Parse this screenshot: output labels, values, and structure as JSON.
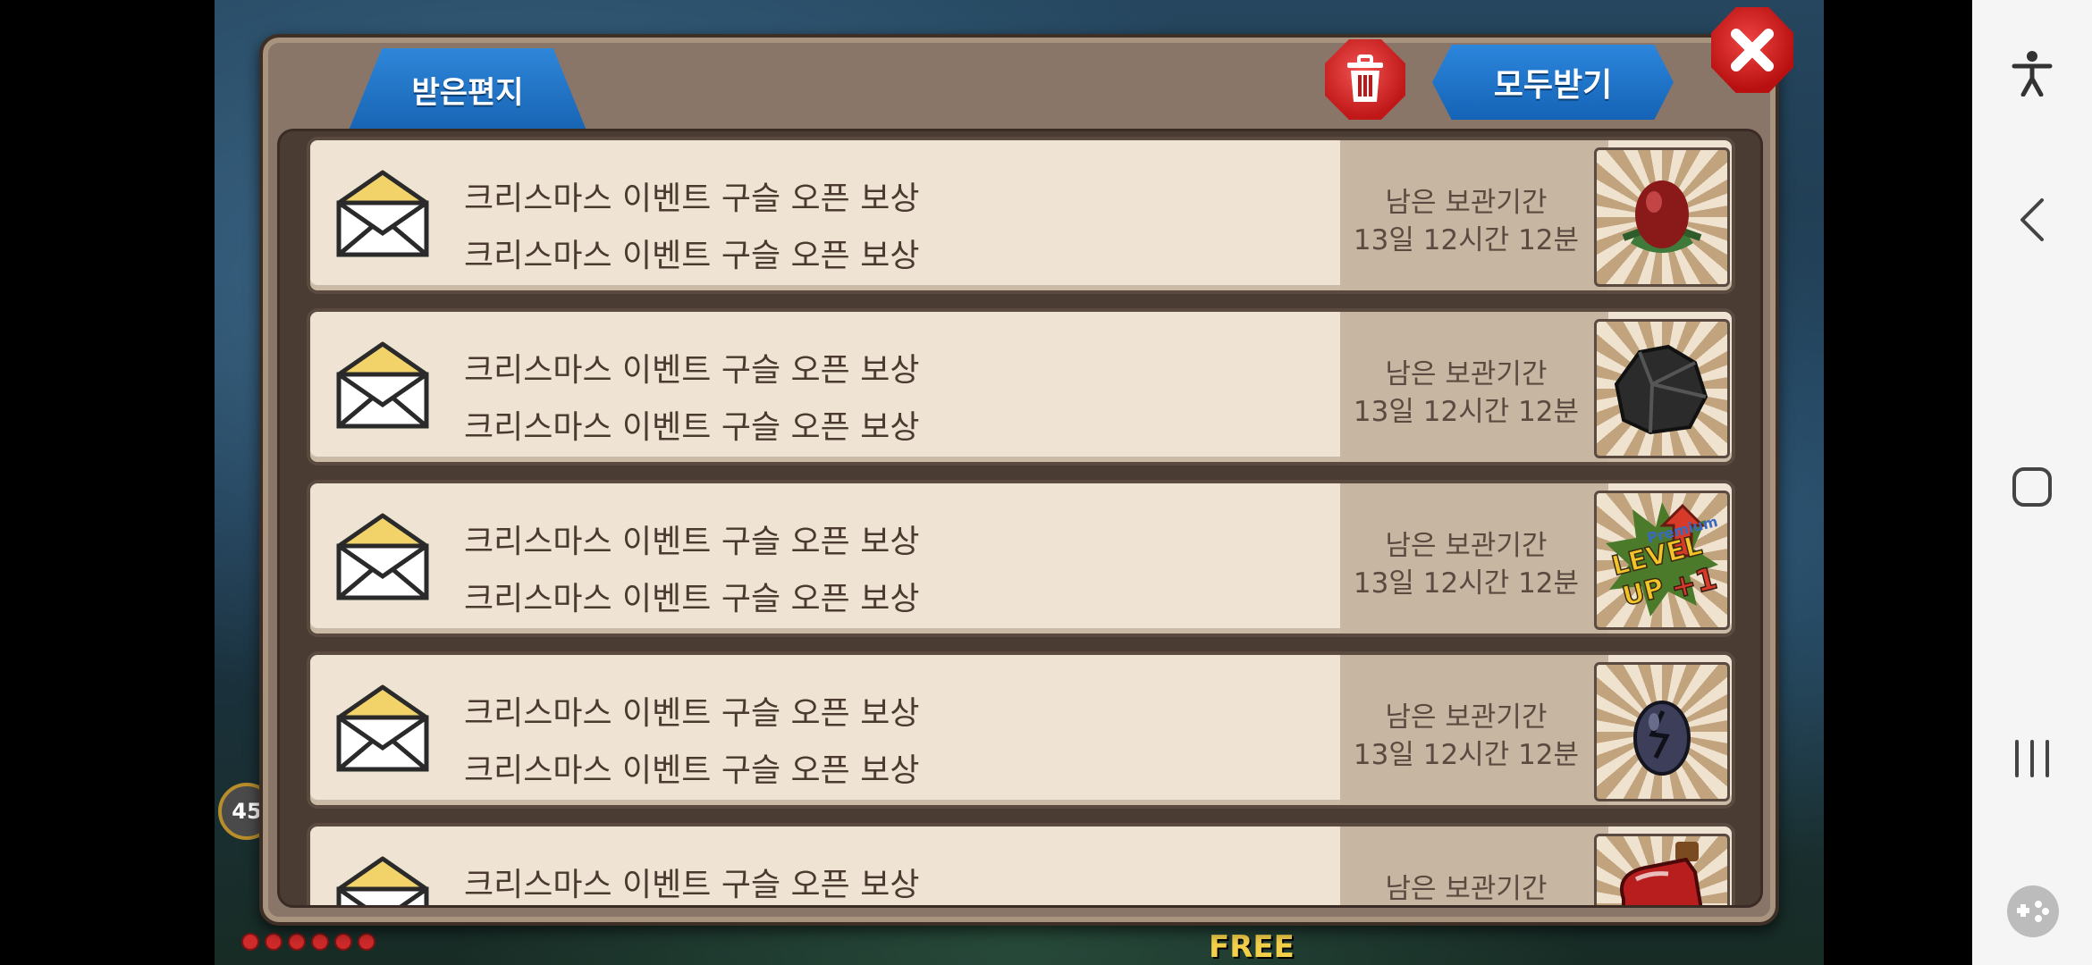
{
  "dialog": {
    "tab_label": "받은편지",
    "receive_all_label": "모두받기"
  },
  "mails": [
    {
      "line1": "크리스마스 이벤트 구슬 오픈 보상",
      "line2": "크리스마스 이벤트 구슬 오픈 보상",
      "expire_label": "남은 보관기간",
      "expire_time": "13일 12시간 12분",
      "item": "red-egg-icon"
    },
    {
      "line1": "크리스마스 이벤트 구슬 오픈 보상",
      "line2": "크리스마스 이벤트 구슬 오픈 보상",
      "expire_label": "남은 보관기간",
      "expire_time": "13일 12시간 12분",
      "item": "ore-rock-icon"
    },
    {
      "line1": "크리스마스 이벤트 구슬 오픈 보상",
      "line2": "크리스마스 이벤트 구슬 오픈 보상",
      "expire_label": "남은 보관기간",
      "expire_time": "13일 12시간 12분",
      "item": "premium-level-up-icon",
      "item_text": [
        "Premium",
        "LEVEL",
        "UP",
        "+1"
      ]
    },
    {
      "line1": "크리스마스 이벤트 구슬 오픈 보상",
      "line2": "크리스마스 이벤트 구슬 오픈 보상",
      "expire_label": "남은 보관기간",
      "expire_time": "13일 12시간 12분",
      "item": "dark-egg-icon"
    },
    {
      "line1": "크리스마스 이벤트 구슬 오픈 보상",
      "line2": "",
      "expire_label": "남은 보관기간",
      "expire_time": "",
      "item": "potion-icon"
    }
  ],
  "background": {
    "level_badge": "45",
    "free_label": "FREE"
  },
  "colors": {
    "tab_blue": "#1f74c8",
    "delete_red": "#d42a2a",
    "panel_brown": "#8a7668",
    "row_cream": "#efe4d4"
  }
}
